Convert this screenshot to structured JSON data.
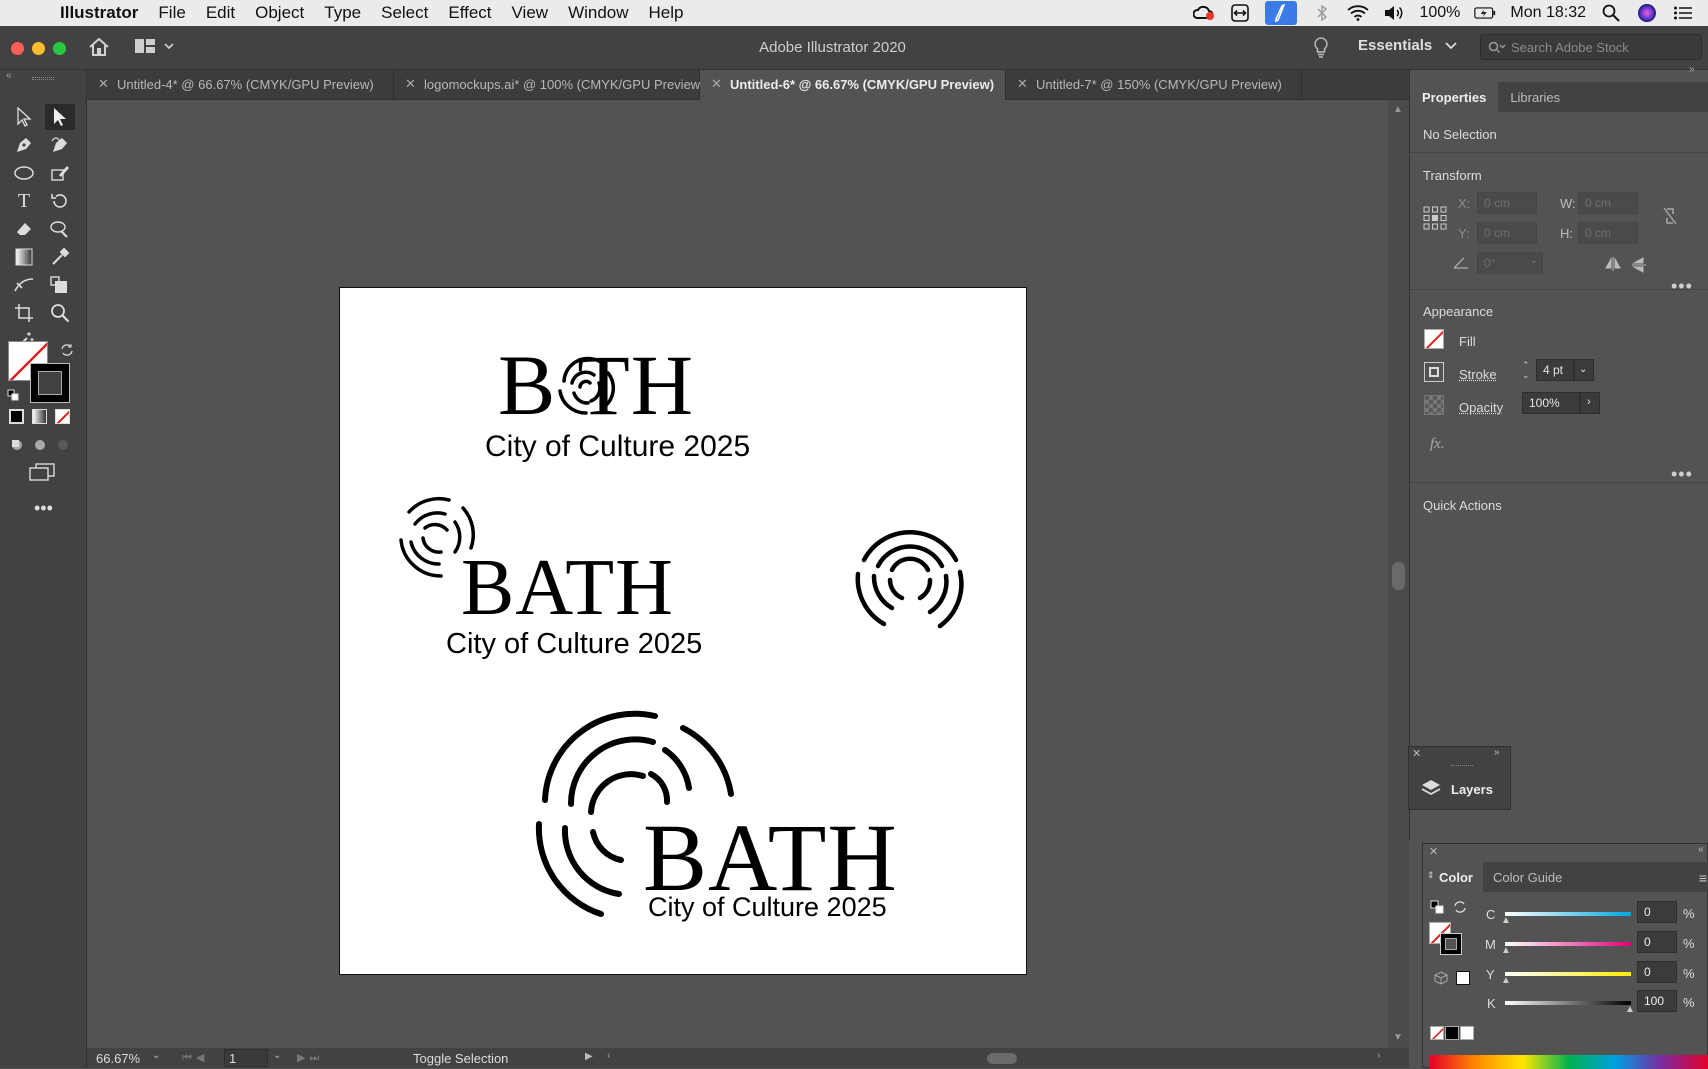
{
  "menubar": {
    "app_name": "Illustrator",
    "items": [
      "File",
      "Edit",
      "Object",
      "Type",
      "Select",
      "Effect",
      "View",
      "Window",
      "Help"
    ],
    "battery": "100%",
    "clock": "Mon 18:32"
  },
  "appbar": {
    "title": "Adobe Illustrator 2020",
    "workspace": "Essentials",
    "search_placeholder": "Search Adobe Stock"
  },
  "tabs": [
    {
      "label": "Untitled-4* @ 66.67% (CMYK/GPU Preview)",
      "active": false
    },
    {
      "label": "logomockups.ai* @ 100% (CMYK/GPU Preview)",
      "active": false
    },
    {
      "label": "Untitled-6* @ 66.67% (CMYK/GPU Preview)",
      "active": true
    },
    {
      "label": "Untitled-7* @ 150% (CMYK/GPU Preview)",
      "active": false
    }
  ],
  "artboard": {
    "logo1": {
      "word": "B  TH",
      "tagline": "City of Culture 2025"
    },
    "logo2": {
      "word": "BATH",
      "tagline": "City of Culture 2025"
    },
    "logo3": {
      "word": "BATH",
      "tagline": "City of Culture 2025"
    }
  },
  "statusbar": {
    "zoom": "66.67%",
    "artboard_number": "1",
    "status_text": "Toggle Selection"
  },
  "properties": {
    "tab_properties": "Properties",
    "tab_libraries": "Libraries",
    "selection": "No Selection",
    "transform_heading": "Transform",
    "x_label": "X:",
    "y_label": "Y:",
    "w_label": "W:",
    "h_label": "H:",
    "x_value": "0 cm",
    "y_value": "0 cm",
    "w_value": "0 cm",
    "h_value": "0 cm",
    "angle_value": "0°",
    "appearance_heading": "Appearance",
    "fill_label": "Fill",
    "stroke_label": "Stroke",
    "stroke_value": "4 pt",
    "opacity_label": "Opacity",
    "opacity_value": "100%",
    "fx_label": "fx.",
    "quick_actions_heading": "Quick Actions"
  },
  "layers_panel": {
    "label": "Layers"
  },
  "color_panel": {
    "tab_color": "Color",
    "tab_color_guide": "Color Guide",
    "channels": [
      {
        "label": "C",
        "value": "0",
        "unit": "%"
      },
      {
        "label": "M",
        "value": "0",
        "unit": "%"
      },
      {
        "label": "Y",
        "value": "0",
        "unit": "%"
      },
      {
        "label": "K",
        "value": "100",
        "unit": "%"
      }
    ]
  },
  "colors": {
    "menubar_bg": "#ebebeb",
    "chrome_dark": "#424242",
    "canvas_bg": "#535353",
    "artboard_bg": "#ffffff",
    "selection_blue": "#3a7be8"
  }
}
